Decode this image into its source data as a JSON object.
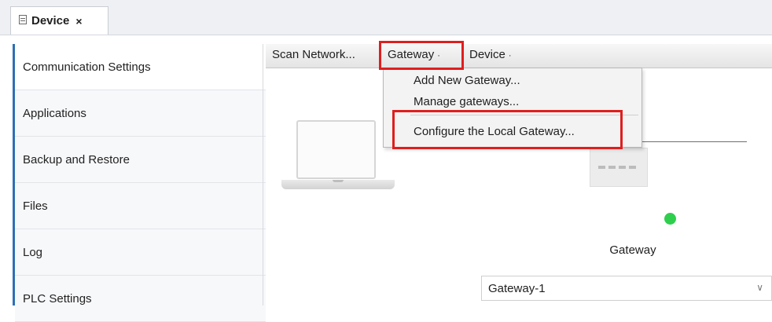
{
  "tab": {
    "title": "Device",
    "close_label": "×"
  },
  "nav": {
    "items": [
      {
        "label": "Communication Settings"
      },
      {
        "label": "Applications"
      },
      {
        "label": "Backup and Restore"
      },
      {
        "label": "Files"
      },
      {
        "label": "Log"
      },
      {
        "label": "PLC Settings"
      }
    ]
  },
  "toolbar": {
    "scan_label": "Scan Network...",
    "gateway_label": "Gateway",
    "device_label": "Device",
    "chevron": "·"
  },
  "menu": {
    "items": [
      {
        "label": "Add New Gateway..."
      },
      {
        "label": "Manage gateways..."
      },
      {
        "label": "Configure the Local Gateway..."
      }
    ]
  },
  "main": {
    "gateway_caption": "Gateway",
    "gateway_select_value": "Gateway-1",
    "status_color": "#2fcf4d"
  },
  "colors": {
    "highlight": "#e01e1e",
    "nav_accent": "#2e6fb5"
  }
}
